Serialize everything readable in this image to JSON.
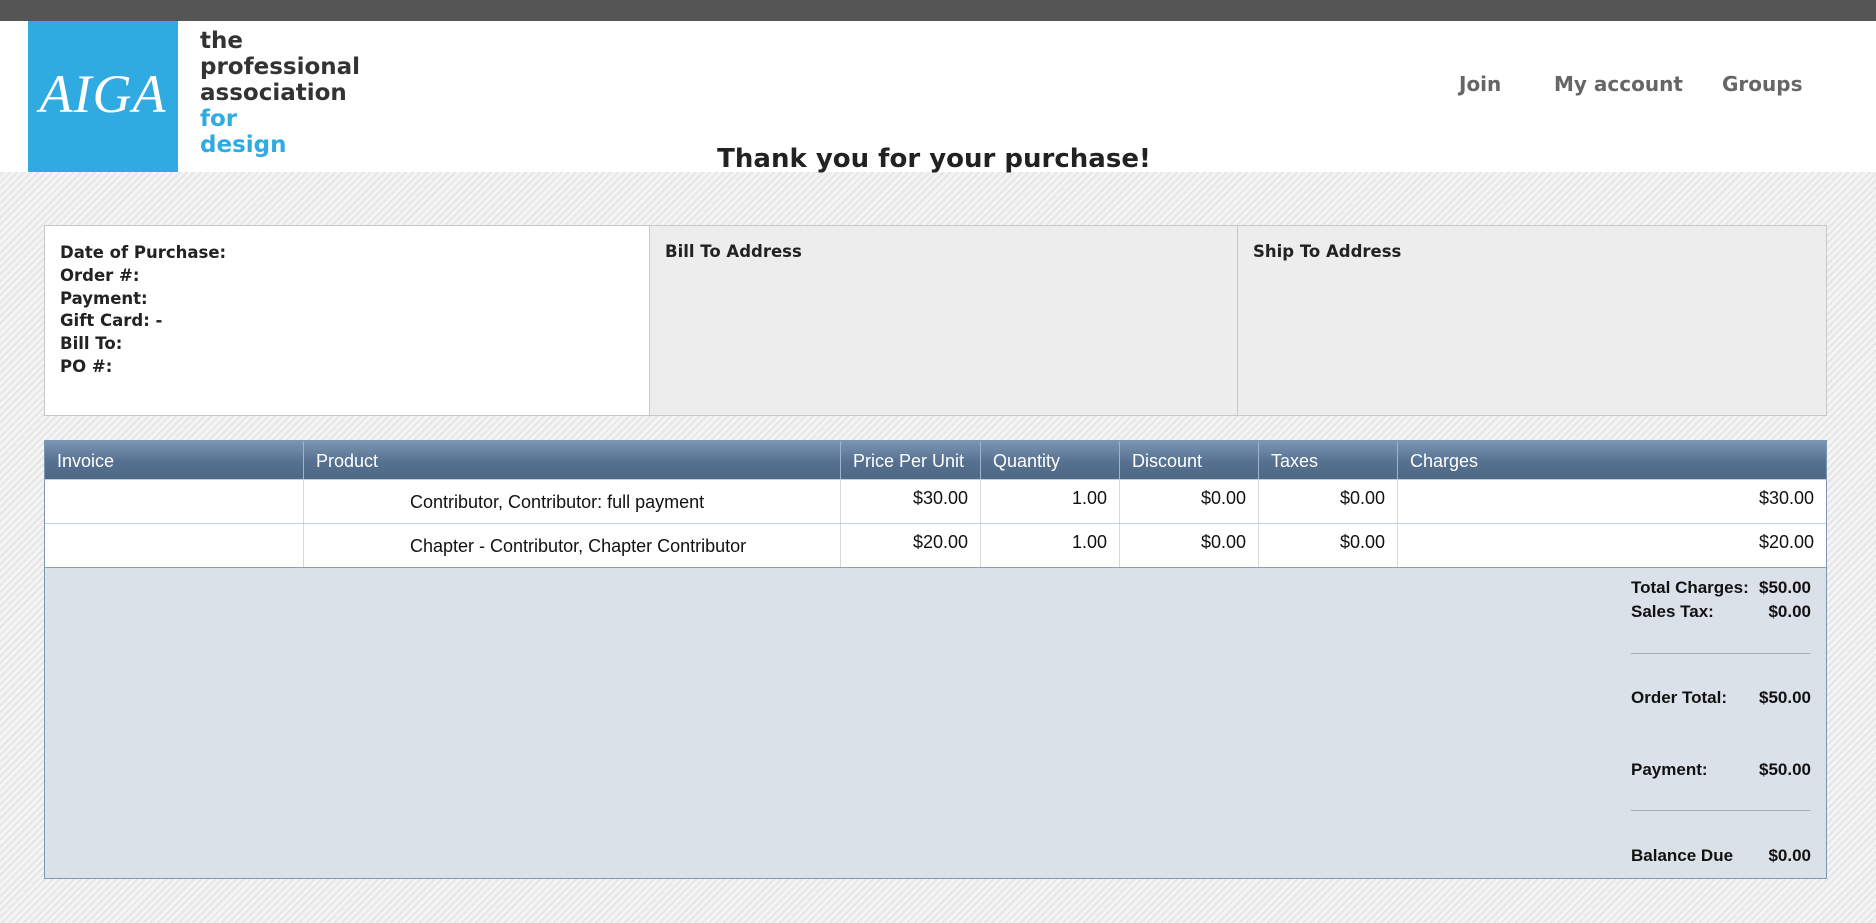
{
  "header": {
    "logo_text": "AIGA",
    "tagline": [
      "the",
      "professional",
      "association",
      "for",
      "design"
    ],
    "nav": [
      "Join",
      "My account",
      "Groups"
    ]
  },
  "page_title": "Thank you for your purchase!",
  "order_info": {
    "fields": [
      "Date of Purchase:",
      "Order #:",
      "Payment:",
      "Gift Card: -",
      "Bill To:",
      "PO #:"
    ],
    "bill_to_heading": "Bill To Address",
    "ship_to_heading": "Ship To Address"
  },
  "table": {
    "headers": [
      "Invoice",
      "Product",
      "Price Per Unit",
      "Quantity",
      "Discount",
      "Taxes",
      "Charges"
    ],
    "rows": [
      {
        "invoice": "",
        "product": "Contributor, Contributor: full payment",
        "price": "$30.00",
        "quantity": "1.00",
        "discount": "$0.00",
        "taxes": "$0.00",
        "charges": "$30.00"
      },
      {
        "invoice": "",
        "product": "Chapter - Contributor, Chapter Contributor",
        "price": "$20.00",
        "quantity": "1.00",
        "discount": "$0.00",
        "taxes": "$0.00",
        "charges": "$20.00"
      }
    ]
  },
  "totals": {
    "total_charges_label": "Total Charges:",
    "total_charges": "$50.00",
    "sales_tax_label": "Sales Tax:",
    "sales_tax": "$0.00",
    "order_total_label": "Order Total:",
    "order_total": "$50.00",
    "payment_label": "Payment:",
    "payment": "$50.00",
    "balance_due_label": "Balance Due",
    "balance_due": "$0.00"
  }
}
